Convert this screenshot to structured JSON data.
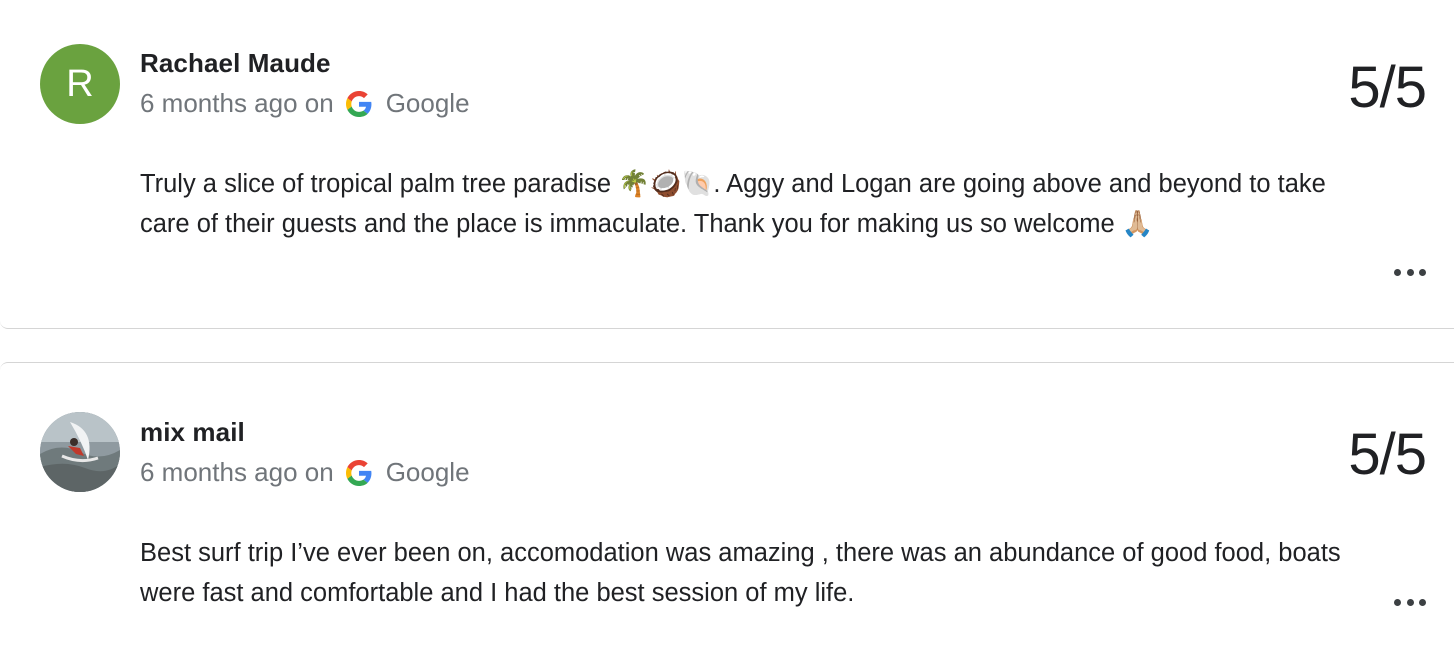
{
  "reviews": [
    {
      "reviewer": "Rachael Maude",
      "avatar_initial": "R",
      "avatar_color": "#6aa23f",
      "time": "6 months ago on",
      "source": "Google",
      "score": "5/5",
      "text": "Truly a slice of tropical palm tree paradise 🌴🥥🐚. Aggy and Logan are going above and beyond to take care of their guests and the place is immaculate. Thank you for making us so welcome 🙏🏼",
      "more_icon": "more-horizontal-icon"
    },
    {
      "reviewer": "mix mail",
      "avatar_image": "surfer-photo",
      "time": "6 months ago on",
      "source": "Google",
      "score": "5/5",
      "text": "Best surf trip I’ve ever been on, accomodation was amazing , there was an abundance of good food, boats were fast and comfortable and I had the best session of my life.",
      "more_icon": "more-horizontal-icon"
    }
  ],
  "colors": {
    "text_primary": "#202124",
    "text_secondary": "#70757a",
    "divider": "#d5d5d5"
  }
}
